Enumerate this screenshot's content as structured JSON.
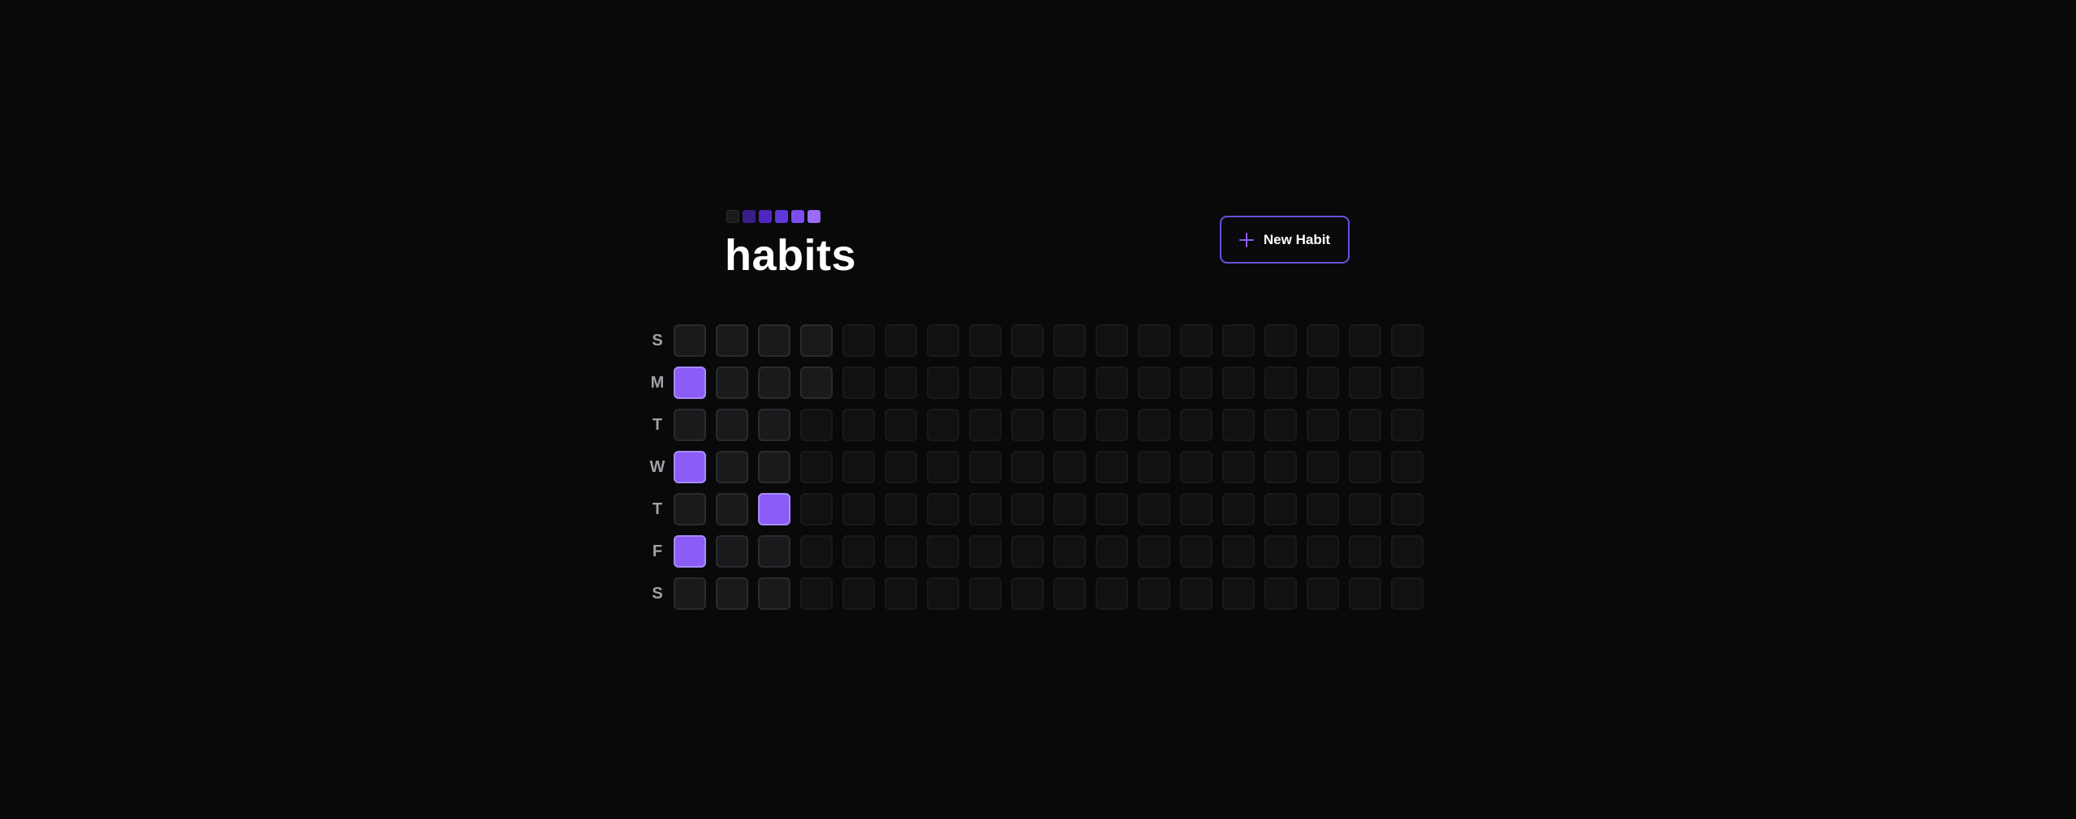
{
  "app": {
    "title": "habits",
    "logo_colors": [
      "#1a1a1c",
      "#3b1d8a",
      "#5125c2",
      "#6236dd",
      "#7c4def",
      "#9b6bfa"
    ]
  },
  "toolbar": {
    "new_habit_label": "New Habit",
    "new_habit_icon": "plus-icon"
  },
  "calendar": {
    "day_labels": [
      "S",
      "M",
      "T",
      "W",
      "T",
      "F",
      "S"
    ],
    "columns": 18,
    "rows": [
      [
        "past",
        "past",
        "past",
        "past",
        "future",
        "future",
        "future",
        "future",
        "future",
        "future",
        "future",
        "future",
        "future",
        "future",
        "future",
        "future",
        "future",
        "future"
      ],
      [
        "done",
        "past",
        "past",
        "past",
        "future",
        "future",
        "future",
        "future",
        "future",
        "future",
        "future",
        "future",
        "future",
        "future",
        "future",
        "future",
        "future",
        "future"
      ],
      [
        "past",
        "past",
        "past",
        "future",
        "future",
        "future",
        "future",
        "future",
        "future",
        "future",
        "future",
        "future",
        "future",
        "future",
        "future",
        "future",
        "future",
        "future"
      ],
      [
        "done",
        "past",
        "past",
        "future",
        "future",
        "future",
        "future",
        "future",
        "future",
        "future",
        "future",
        "future",
        "future",
        "future",
        "future",
        "future",
        "future",
        "future"
      ],
      [
        "past",
        "past",
        "done",
        "future",
        "future",
        "future",
        "future",
        "future",
        "future",
        "future",
        "future",
        "future",
        "future",
        "future",
        "future",
        "future",
        "future",
        "future"
      ],
      [
        "done",
        "past",
        "past",
        "future",
        "future",
        "future",
        "future",
        "future",
        "future",
        "future",
        "future",
        "future",
        "future",
        "future",
        "future",
        "future",
        "future",
        "future"
      ],
      [
        "past",
        "past",
        "past",
        "future",
        "future",
        "future",
        "future",
        "future",
        "future",
        "future",
        "future",
        "future",
        "future",
        "future",
        "future",
        "future",
        "future",
        "future"
      ]
    ]
  },
  "colors": {
    "accent": "#8b5cf6",
    "accent_border": "#6d4fd9",
    "background": "#09090a"
  }
}
